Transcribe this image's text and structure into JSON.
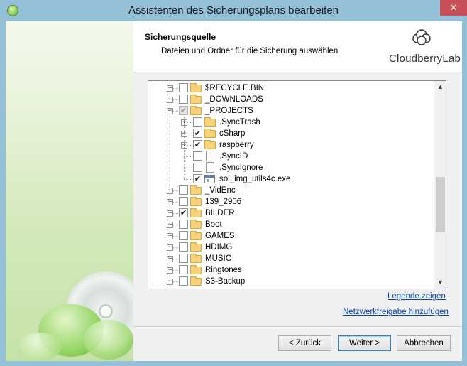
{
  "window": {
    "title": "Assistenten des Sicherungsplans bearbeiten",
    "close_symbol": "✕"
  },
  "header": {
    "title": "Sicherungsquelle",
    "subtitle": "Dateien und Ordner für die Sicherung auswählen",
    "logo_text": "CloudberryLab"
  },
  "tree": {
    "items": [
      {
        "label": "$RECYCLE.BIN",
        "level": 0,
        "expander": "+",
        "checked": false,
        "icon": "folder-icon"
      },
      {
        "label": "_DOWNLOADS",
        "level": 0,
        "expander": "+",
        "checked": false,
        "icon": "folder-icon"
      },
      {
        "label": "_PROJECTS",
        "level": 0,
        "expander": "−",
        "checked": "partial",
        "icon": "folder-icon"
      },
      {
        "label": ".SyncTrash",
        "level": 1,
        "expander": "+",
        "checked": false,
        "icon": "folder-icon"
      },
      {
        "label": "cSharp",
        "level": 1,
        "expander": "+",
        "checked": true,
        "icon": "folder-icon"
      },
      {
        "label": "raspberry",
        "level": 1,
        "expander": "+",
        "checked": true,
        "icon": "folder-icon"
      },
      {
        "label": ".SyncID",
        "level": 1,
        "expander": "",
        "checked": false,
        "icon": "file-icon"
      },
      {
        "label": ".SyncIgnore",
        "level": 1,
        "expander": "",
        "checked": false,
        "icon": "file-icon"
      },
      {
        "label": "sol_img_utils4c.exe",
        "level": 1,
        "expander": "",
        "checked": true,
        "icon": "exe-file-icon"
      },
      {
        "label": "_VidEnc",
        "level": 0,
        "expander": "+",
        "checked": false,
        "icon": "folder-icon"
      },
      {
        "label": "139_2906",
        "level": 0,
        "expander": "+",
        "checked": false,
        "icon": "folder-icon"
      },
      {
        "label": "BILDER",
        "level": 0,
        "expander": "+",
        "checked": true,
        "icon": "folder-icon"
      },
      {
        "label": "Boot",
        "level": 0,
        "expander": "+",
        "checked": false,
        "icon": "folder-icon"
      },
      {
        "label": "GAMES",
        "level": 0,
        "expander": "+",
        "checked": false,
        "icon": "folder-icon"
      },
      {
        "label": "HDIMG",
        "level": 0,
        "expander": "+",
        "checked": false,
        "icon": "folder-icon"
      },
      {
        "label": "MUSIC",
        "level": 0,
        "expander": "+",
        "checked": false,
        "icon": "folder-icon"
      },
      {
        "label": "Ringtones",
        "level": 0,
        "expander": "+",
        "checked": false,
        "icon": "folder-icon"
      },
      {
        "label": "S3-Backup",
        "level": 0,
        "expander": "+",
        "checked": false,
        "icon": "folder-icon"
      }
    ]
  },
  "scrollbar": {
    "up": "▲",
    "down": "▼"
  },
  "links": {
    "legend": "Legende zeigen",
    "network": "Netzwerkfreigabe hinzufügen"
  },
  "buttons": {
    "back": "< Zurück",
    "next": "Weiter >",
    "cancel": "Abbrechen"
  },
  "colors": {
    "frame": "#93c0d7",
    "close_button": "#c7505a",
    "link": "#0645ad"
  }
}
